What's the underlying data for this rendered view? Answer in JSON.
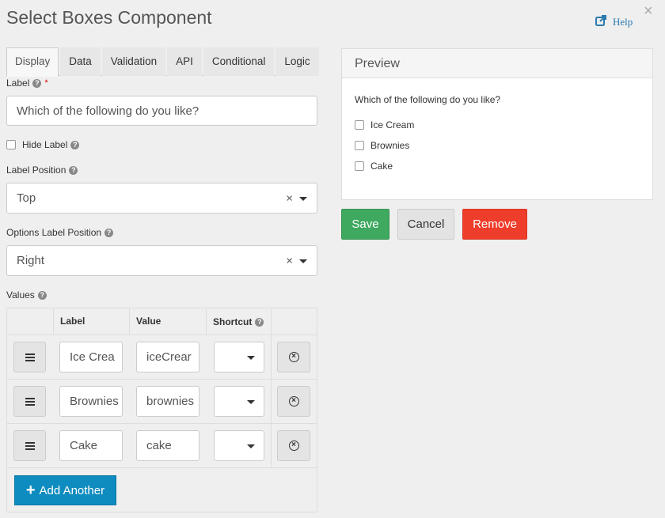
{
  "dialog": {
    "title": "Select Boxes Component",
    "help_label": "Help",
    "close_glyph": "×"
  },
  "tabs": [
    {
      "label": "Display",
      "active": true
    },
    {
      "label": "Data"
    },
    {
      "label": "Validation"
    },
    {
      "label": "API"
    },
    {
      "label": "Conditional"
    },
    {
      "label": "Logic"
    }
  ],
  "form": {
    "label_field": {
      "label": "Label",
      "required_mark": "*",
      "value": "Which of the following do you like?"
    },
    "hide_label": {
      "label": "Hide Label",
      "checked": false
    },
    "label_position": {
      "label": "Label Position",
      "value": "Top",
      "clear_glyph": "×"
    },
    "options_label_position": {
      "label": "Options Label Position",
      "value": "Right",
      "clear_glyph": "×"
    },
    "values": {
      "label": "Values",
      "headers": {
        "label": "Label",
        "value": "Value",
        "shortcut": "Shortcut"
      },
      "rows": [
        {
          "label": "Ice Crea",
          "value": "iceCrear",
          "shortcut": ""
        },
        {
          "label": "Brownies",
          "value": "brownies",
          "shortcut": ""
        },
        {
          "label": "Cake",
          "value": "cake",
          "shortcut": ""
        }
      ],
      "add_button": "Add Another",
      "add_glyph": "+"
    }
  },
  "preview": {
    "title": "Preview",
    "question": "Which of the following do you like?",
    "options": [
      "Ice Cream",
      "Brownies",
      "Cake"
    ]
  },
  "actions": {
    "save": "Save",
    "cancel": "Cancel",
    "remove": "Remove"
  },
  "colors": {
    "save": "#3fa960",
    "remove": "#ee3d2a",
    "add": "#0e8cbf",
    "link": "#2a7ab0"
  }
}
